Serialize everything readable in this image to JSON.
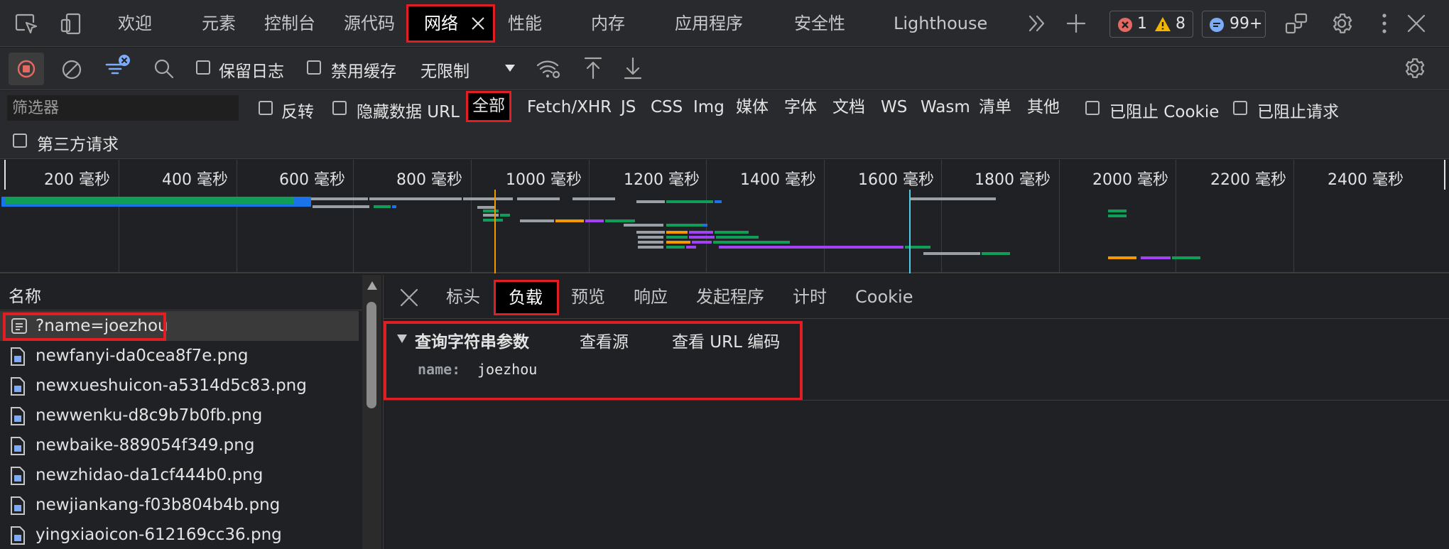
{
  "tabs": {
    "welcome": "欢迎",
    "elements": "元素",
    "console": "控制台",
    "sources": "源代码",
    "network": "网络",
    "performance": "性能",
    "memory": "内存",
    "application": "应用程序",
    "security": "安全性",
    "lighthouse": "Lighthouse"
  },
  "badges": {
    "errors": "1",
    "warnings": "8",
    "messages": "99+"
  },
  "toolbar": {
    "preserve_log": "保留日志",
    "disable_cache": "禁用缓存",
    "throttling": "无限制"
  },
  "filter": {
    "placeholder": "筛选器",
    "invert": "反转",
    "hide_data_urls": "隐藏数据 URL",
    "types": [
      "全部",
      "Fetch/XHR",
      "JS",
      "CSS",
      "Img",
      "媒体",
      "字体",
      "文档",
      "WS",
      "Wasm",
      "清单",
      "其他"
    ],
    "blocked_cookies": "已阻止 Cookie",
    "blocked_requests": "已阻止请求",
    "third_party": "第三方请求"
  },
  "overview": {
    "unit": "毫秒",
    "ticks": [
      "200",
      "400",
      "600",
      "800",
      "1000",
      "1200",
      "1400",
      "1600",
      "1800",
      "2000",
      "2200",
      "2400"
    ],
    "colors": {
      "green": "#0f9d58",
      "blue": "#1a73e8",
      "gray": "#9aa0a6",
      "orange": "#f29900",
      "purple": "#a142f4"
    }
  },
  "requests": {
    "header": "名称",
    "items": [
      "?name=joezhou",
      "newfanyi-da0cea8f7e.png",
      "newxueshuicon-a5314d5c83.png",
      "newwenku-d8c9b7b0fb.png",
      "newbaike-889054f349.png",
      "newzhidao-da1cf444b0.png",
      "newjiankang-f03b804b4b.png",
      "yingxiaoicon-612169cc36.png"
    ]
  },
  "detail": {
    "tabs": [
      "标头",
      "负载",
      "预览",
      "响应",
      "发起程序",
      "计时",
      "Cookie"
    ],
    "payload": {
      "section": "查询字符串参数",
      "view_source": "查看源",
      "view_url_encoded": "查看 URL 编码",
      "param_name": "name:",
      "param_value": "joezhou"
    }
  }
}
